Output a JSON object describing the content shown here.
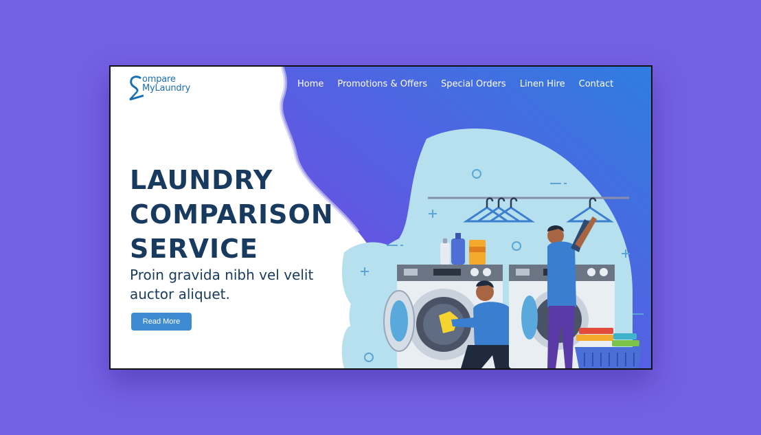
{
  "logo": {
    "line1": "ompare",
    "line2": "MyLaundry",
    "icon": "hanger-c-icon"
  },
  "nav": {
    "items": [
      {
        "label": "Home"
      },
      {
        "label": "Promotions & Offers"
      },
      {
        "label": "Special Orders"
      },
      {
        "label": "Linen Hire"
      },
      {
        "label": "Contact"
      }
    ]
  },
  "hero": {
    "headline_line1": "LAUNDRY",
    "headline_line2": "COMPARISON",
    "headline_line3": "SERVICE",
    "subtext": "Proin gravida nibh vel velit auctor aliquet.",
    "cta_label": "Read More"
  },
  "colors": {
    "page_background": "#7460e3",
    "headline": "#183a5e",
    "accent_blue": "#3e8bd1",
    "gradient_start": "#7b44e3",
    "gradient_end": "#2f7de0",
    "blob": "#b7e0ef"
  },
  "illustration": {
    "description_icons": [
      "washing-machine-icon",
      "hanger-icon",
      "laundry-basket-icon",
      "detergent-bottle-icon",
      "person-icon"
    ]
  }
}
